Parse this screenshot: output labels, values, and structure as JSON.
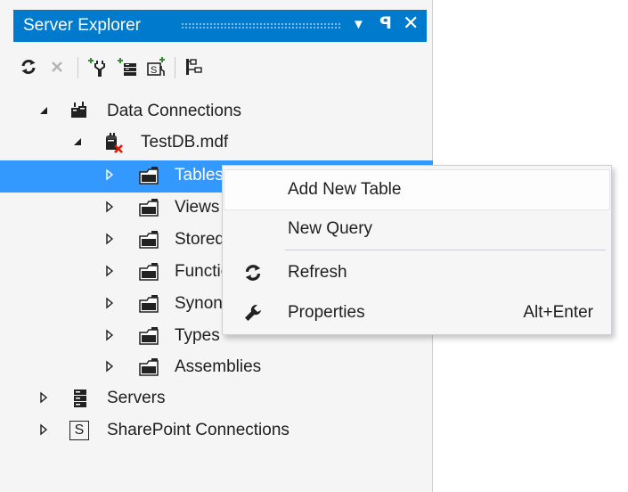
{
  "window": {
    "title": "Server Explorer",
    "dropdown_glyph": "▼",
    "pin_glyph": "ꟼ",
    "close_glyph": "✕"
  },
  "toolbar": {
    "buttons": [
      "refresh-icon",
      "stop-icon",
      "connect-to-database-icon",
      "connect-to-server-icon",
      "connect-to-sharepoint-icon",
      "properties-icon"
    ]
  },
  "tree": {
    "data_connections": "Data Connections",
    "database": "TestDB.mdf",
    "tables": "Tables",
    "views": "Views",
    "stored_procedures": "Stored Procedures",
    "functions": "Functions",
    "synonyms": "Synonyms",
    "types": "Types",
    "assemblies": "Assemblies",
    "servers": "Servers",
    "sharepoint": "SharePoint Connections",
    "sharepoint_glyph": "S"
  },
  "context_menu": {
    "add_new_table": "Add New Table",
    "new_query": "New Query",
    "refresh": "Refresh",
    "properties": "Properties",
    "properties_shortcut": "Alt+Enter"
  },
  "colors": {
    "accent": "#007acc",
    "selection": "#3399ff",
    "panel_bg": "#f5f5f5",
    "menu_bg": "#f6f6f6"
  }
}
